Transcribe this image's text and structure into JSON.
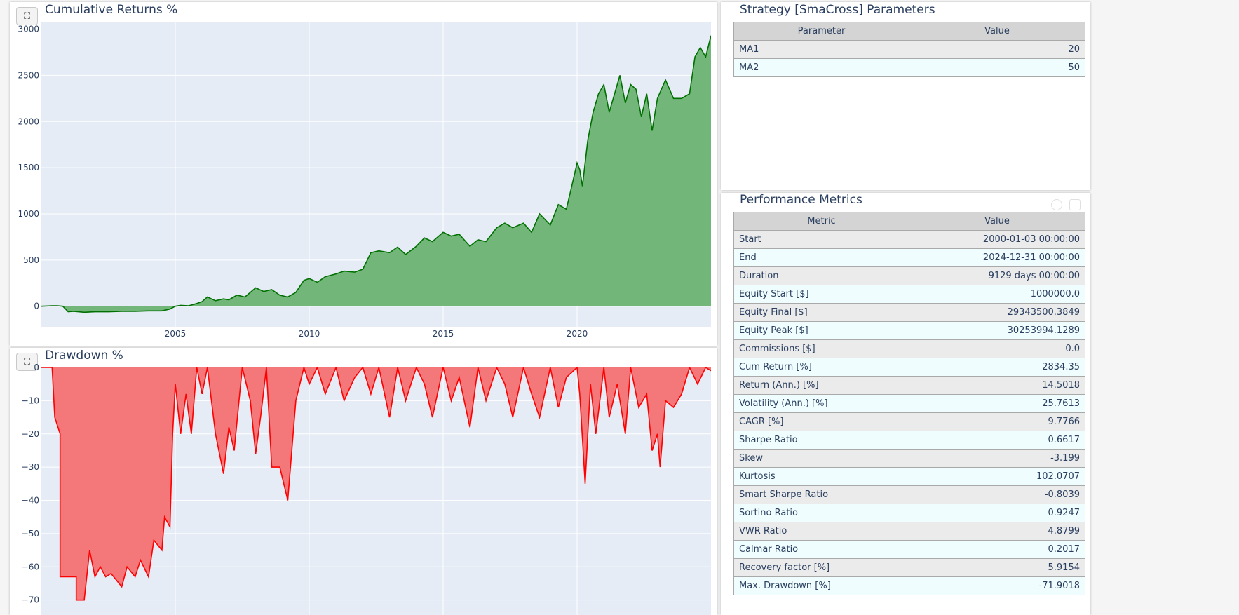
{
  "colors": {
    "plot_bg": "#e5ecf6",
    "grid": "#ffffff",
    "returns_line": "#007000",
    "returns_fill": "#72b779",
    "drawdown_line": "#ff0000",
    "drawdown_fill": "#f47779",
    "title": "#2a3f5f"
  },
  "returns_panel": {
    "title": "Cumulative Returns %",
    "expand_icon": "fullscreen-icon"
  },
  "drawdown_panel": {
    "title": "Drawdown %",
    "expand_icon": "fullscreen-icon"
  },
  "params_panel": {
    "title": "Strategy [SmaCross] Parameters",
    "headers": [
      "Parameter",
      "Value"
    ],
    "rows": [
      {
        "name": "MA1",
        "value": "20"
      },
      {
        "name": "MA2",
        "value": "50"
      }
    ]
  },
  "metrics_panel": {
    "title": "Performance Metrics",
    "headers": [
      "Metric",
      "Value"
    ],
    "rows": [
      {
        "name": "Start",
        "value": "2000-01-03 00:00:00"
      },
      {
        "name": "End",
        "value": "2024-12-31 00:00:00"
      },
      {
        "name": "Duration",
        "value": "9129 days 00:00:00"
      },
      {
        "name": "Equity Start [$]",
        "value": "1000000.0"
      },
      {
        "name": "Equity Final [$]",
        "value": "29343500.3849"
      },
      {
        "name": "Equity Peak [$]",
        "value": "30253994.1289"
      },
      {
        "name": "Commissions [$]",
        "value": "0.0"
      },
      {
        "name": "Cum Return [%]",
        "value": "2834.35"
      },
      {
        "name": "Return (Ann.) [%]",
        "value": "14.5018"
      },
      {
        "name": "Volatility (Ann.) [%]",
        "value": "25.7613"
      },
      {
        "name": "CAGR [%]",
        "value": "9.7766"
      },
      {
        "name": "Sharpe Ratio",
        "value": "0.6617"
      },
      {
        "name": "Skew",
        "value": "-3.199"
      },
      {
        "name": "Kurtosis",
        "value": "102.0707"
      },
      {
        "name": "Smart Sharpe Ratio",
        "value": "-0.8039"
      },
      {
        "name": "Sortino Ratio",
        "value": "0.9247"
      },
      {
        "name": "VWR Ratio",
        "value": "4.8799"
      },
      {
        "name": "Calmar Ratio",
        "value": "0.2017"
      },
      {
        "name": "Recovery factor [%]",
        "value": "5.9154"
      },
      {
        "name": "Max. Drawdown [%]",
        "value": "-71.9018"
      }
    ]
  },
  "chart_data": [
    {
      "type": "area",
      "title": "Cumulative Returns %",
      "xlabel": "",
      "ylabel": "",
      "x_ticks": [
        "2005",
        "2010",
        "2015",
        "2020"
      ],
      "y_ticks": [
        "0",
        "500",
        "1000",
        "1500",
        "2000",
        "2500",
        "3000"
      ],
      "xlim": [
        2000.0,
        2025.0
      ],
      "ylim": [
        -230,
        3080
      ],
      "grid": true,
      "series": [
        {
          "x": [
            2000.0,
            2000.4,
            2000.6,
            2000.8,
            2001.0,
            2001.2,
            2001.6,
            2002.0,
            2002.5,
            2003.0,
            2003.5,
            2004.0,
            2004.5,
            2004.8,
            2005.0,
            2005.2,
            2005.5,
            2005.8,
            2006.0,
            2006.2,
            2006.5,
            2006.8,
            2007.0,
            2007.3,
            2007.6,
            2008.0,
            2008.3,
            2008.6,
            2008.9,
            2009.2,
            2009.5,
            2009.8,
            2010.0,
            2010.3,
            2010.6,
            2011.0,
            2011.3,
            2011.7,
            2012.0,
            2012.3,
            2012.6,
            2013.0,
            2013.3,
            2013.6,
            2014.0,
            2014.3,
            2014.6,
            2015.0,
            2015.3,
            2015.6,
            2016.0,
            2016.3,
            2016.6,
            2017.0,
            2017.3,
            2017.6,
            2018.0,
            2018.3,
            2018.6,
            2019.0,
            2019.3,
            2019.6,
            2019.8,
            2020.0,
            2020.1,
            2020.2,
            2020.4,
            2020.6,
            2020.8,
            2021.0,
            2021.2,
            2021.4,
            2021.6,
            2021.8,
            2022.0,
            2022.2,
            2022.4,
            2022.6,
            2022.8,
            2023.0,
            2023.3,
            2023.6,
            2023.9,
            2024.2,
            2024.4,
            2024.6,
            2024.8,
            2025.0
          ],
          "values": [
            0,
            5,
            5,
            0,
            -60,
            -55,
            -65,
            -60,
            -60,
            -55,
            -55,
            -50,
            -50,
            -30,
            0,
            10,
            5,
            30,
            50,
            100,
            60,
            80,
            70,
            120,
            100,
            200,
            160,
            180,
            120,
            100,
            150,
            280,
            300,
            260,
            320,
            350,
            380,
            370,
            400,
            580,
            600,
            580,
            640,
            560,
            650,
            740,
            700,
            800,
            760,
            780,
            650,
            720,
            700,
            850,
            900,
            850,
            900,
            800,
            1000,
            880,
            1100,
            1050,
            1300,
            1550,
            1480,
            1300,
            1800,
            2100,
            2300,
            2400,
            2100,
            2300,
            2500,
            2200,
            2400,
            2350,
            2050,
            2300,
            1900,
            2250,
            2450,
            2250,
            2250,
            2300,
            2700,
            2800,
            2700,
            2930
          ]
        }
      ]
    },
    {
      "type": "area",
      "title": "Drawdown %",
      "xlabel": "",
      "ylabel": "",
      "y_ticks": [
        "0",
        "−10",
        "−20",
        "−30",
        "−40",
        "−50",
        "−60",
        "−70"
      ],
      "xlim": [
        2000.0,
        2025.0
      ],
      "ylim": [
        -74.5,
        0
      ],
      "grid": true,
      "series": [
        {
          "x": [
            2000.0,
            2000.4,
            2000.5,
            2000.7,
            2000.7,
            2001.3,
            2001.3,
            2001.6,
            2001.8,
            2002.0,
            2002.2,
            2002.4,
            2002.6,
            2003.0,
            2003.2,
            2003.5,
            2003.7,
            2004.0,
            2004.2,
            2004.5,
            2004.6,
            2004.8,
            2004.9,
            2005.0,
            2005.2,
            2005.4,
            2005.6,
            2005.8,
            2006.0,
            2006.2,
            2006.5,
            2006.8,
            2007.0,
            2007.2,
            2007.5,
            2007.8,
            2008.0,
            2008.2,
            2008.4,
            2008.6,
            2008.9,
            2009.2,
            2009.5,
            2009.8,
            2010.0,
            2010.3,
            2010.6,
            2011.0,
            2011.3,
            2011.7,
            2012.0,
            2012.3,
            2012.6,
            2013.0,
            2013.3,
            2013.6,
            2014.0,
            2014.3,
            2014.6,
            2015.0,
            2015.3,
            2015.6,
            2016.0,
            2016.3,
            2016.6,
            2017.0,
            2017.3,
            2017.6,
            2018.0,
            2018.3,
            2018.6,
            2019.0,
            2019.3,
            2019.6,
            2020.0,
            2020.1,
            2020.3,
            2020.5,
            2020.7,
            2021.0,
            2021.2,
            2021.5,
            2021.8,
            2022.0,
            2022.3,
            2022.6,
            2022.8,
            2023.0,
            2023.1,
            2023.3,
            2023.6,
            2023.9,
            2024.2,
            2024.5,
            2024.8,
            2025.0
          ],
          "values": [
            0,
            0,
            -15,
            -20,
            -63,
            -63,
            -70,
            -70,
            -55,
            -63,
            -60,
            -63,
            -62,
            -66,
            -60,
            -63,
            -58,
            -63,
            -52,
            -55,
            -45,
            -48,
            -20,
            -5,
            -20,
            -8,
            -20,
            0,
            -8,
            0,
            -20,
            -32,
            -18,
            -25,
            0,
            -10,
            -26,
            -14,
            0,
            -30,
            -30,
            -40,
            -10,
            0,
            -5,
            0,
            -8,
            0,
            -10,
            -3,
            0,
            -8,
            0,
            -15,
            0,
            -10,
            0,
            -5,
            -15,
            0,
            -10,
            -3,
            -18,
            0,
            -10,
            0,
            -5,
            -15,
            0,
            -8,
            -15,
            0,
            -12,
            -3,
            0,
            -8,
            -35,
            -5,
            -20,
            0,
            -15,
            -5,
            -20,
            0,
            -12,
            -8,
            -25,
            -20,
            -30,
            -10,
            -12,
            -8,
            0,
            -5,
            0,
            -1
          ]
        }
      ]
    }
  ]
}
